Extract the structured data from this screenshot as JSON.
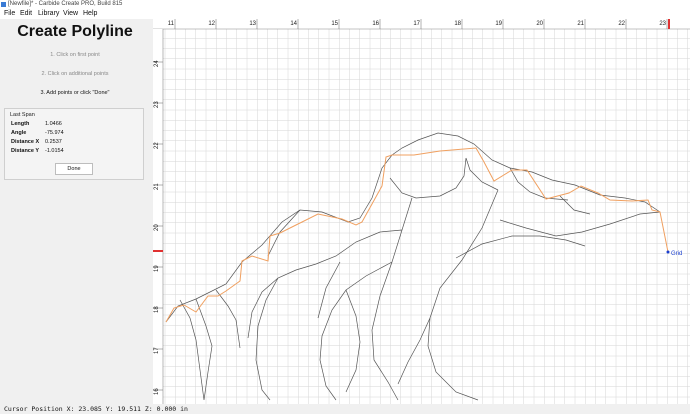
{
  "window": {
    "title": "[Newfile]* - Carbide Create PRO, Build 815"
  },
  "menu": {
    "items": [
      "File",
      "Edit",
      "Library",
      "View",
      "Help"
    ]
  },
  "panel": {
    "title": "Create Polyline",
    "steps": [
      "1. Click on first point",
      "2. Click on additional points",
      "3. Add points or click \"Done\""
    ],
    "active_step": 3,
    "last_span": {
      "heading": "Last Span",
      "rows": [
        {
          "label": "Length",
          "value": "1.0466"
        },
        {
          "label": "Angle",
          "value": "-75.974"
        },
        {
          "label": "Distance X",
          "value": "0.2537"
        },
        {
          "label": "Distance Y",
          "value": "-1.0154"
        }
      ]
    },
    "done_label": "Done"
  },
  "canvas": {
    "x_ticks": [
      "11",
      "12",
      "13",
      "14",
      "15",
      "16",
      "17",
      "18",
      "19",
      "20",
      "21",
      "22",
      "23"
    ],
    "y_ticks": [
      "24",
      "23",
      "22",
      "21",
      "20",
      "19",
      "18",
      "17",
      "16"
    ],
    "snap_label": "Grid",
    "colors": {
      "polyline": "#f0a060",
      "contour": "#555555",
      "grid": "#d6d6d6",
      "marker": "#e03030",
      "snap": "#1a3fcf"
    }
  },
  "status": {
    "text": "Cursor Position X: 23.085 Y: 19.511 Z: 0.000 in"
  }
}
